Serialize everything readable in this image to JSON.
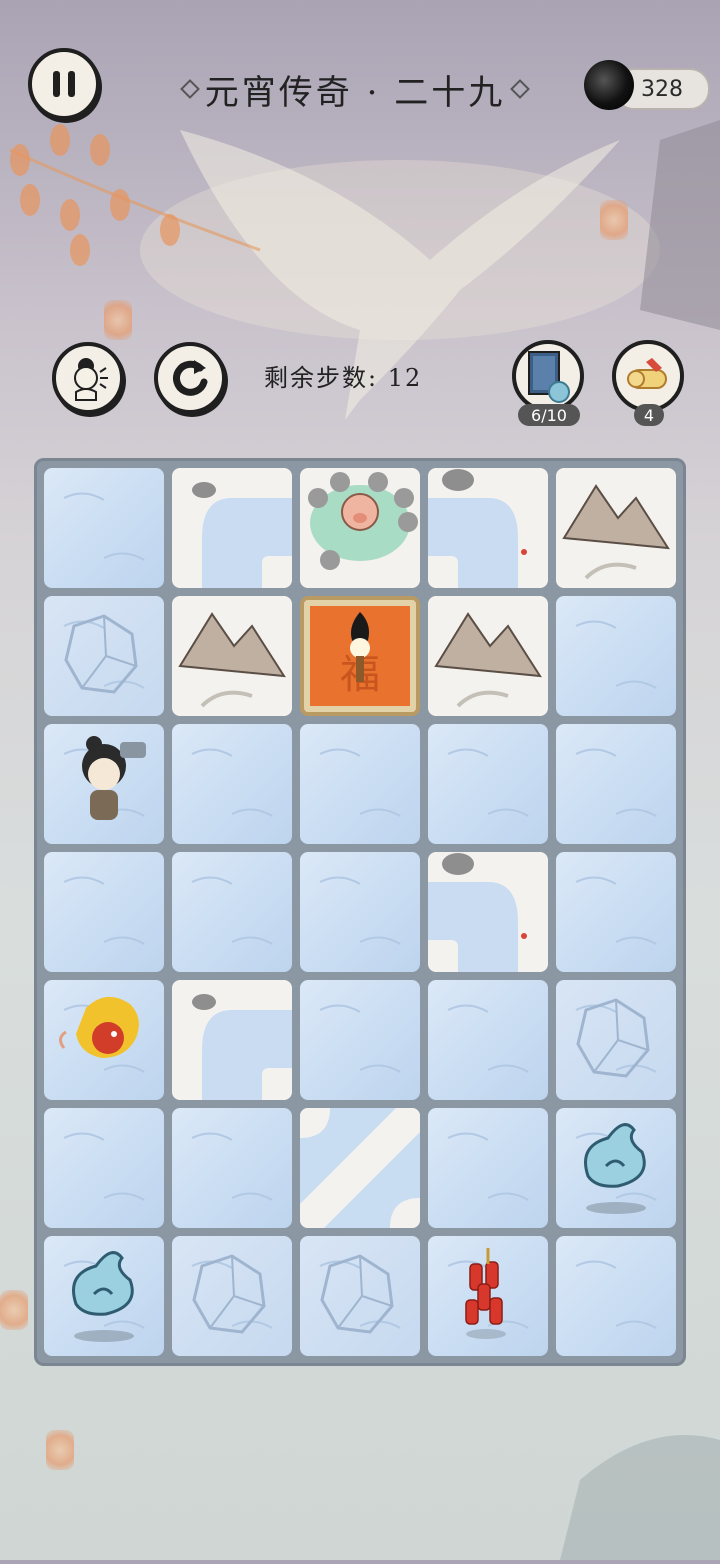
{
  "level": {
    "title": "元宵传奇 · 二十九"
  },
  "currency": {
    "ink": "328"
  },
  "hud": {
    "steps_label": "剩余步数:",
    "steps_value": "12"
  },
  "items": [
    {
      "name": "book",
      "count": "6/10"
    },
    {
      "name": "scroll",
      "count": "4"
    }
  ],
  "board": {
    "rows": 7,
    "cols": 5,
    "tiles": [
      [
        "ice",
        "snow-curve-br",
        "snow-pond",
        "snow-curve-bl",
        "snow-mountain"
      ],
      [
        "cracked",
        "snow-mountain",
        "fortune",
        "snow-mountain",
        "ice"
      ],
      [
        "ice",
        "ice",
        "ice",
        "ice",
        "ice"
      ],
      [
        "ice",
        "ice",
        "ice",
        "snow-curve-bl",
        "ice"
      ],
      [
        "ice",
        "snow-curve-br",
        "ice",
        "ice",
        "cracked"
      ],
      [
        "ice",
        "ice",
        "snow-diagonal",
        "ice",
        "ice"
      ],
      [
        "ice",
        "cracked",
        "cracked",
        "ice",
        "ice"
      ]
    ],
    "fortune_char": "福",
    "pieces": [
      {
        "name": "player-character",
        "row": 2,
        "col": 0
      },
      {
        "name": "nian-beast",
        "row": 4,
        "col": 0
      },
      {
        "name": "pig-in-pond",
        "row": 0,
        "col": 2
      },
      {
        "name": "torch-on-fortune",
        "row": 1,
        "col": 2
      },
      {
        "name": "blue-spirit",
        "row": 5,
        "col": 4
      },
      {
        "name": "blue-spirit",
        "row": 6,
        "col": 0
      },
      {
        "name": "firecracker",
        "row": 6,
        "col": 3
      }
    ]
  }
}
